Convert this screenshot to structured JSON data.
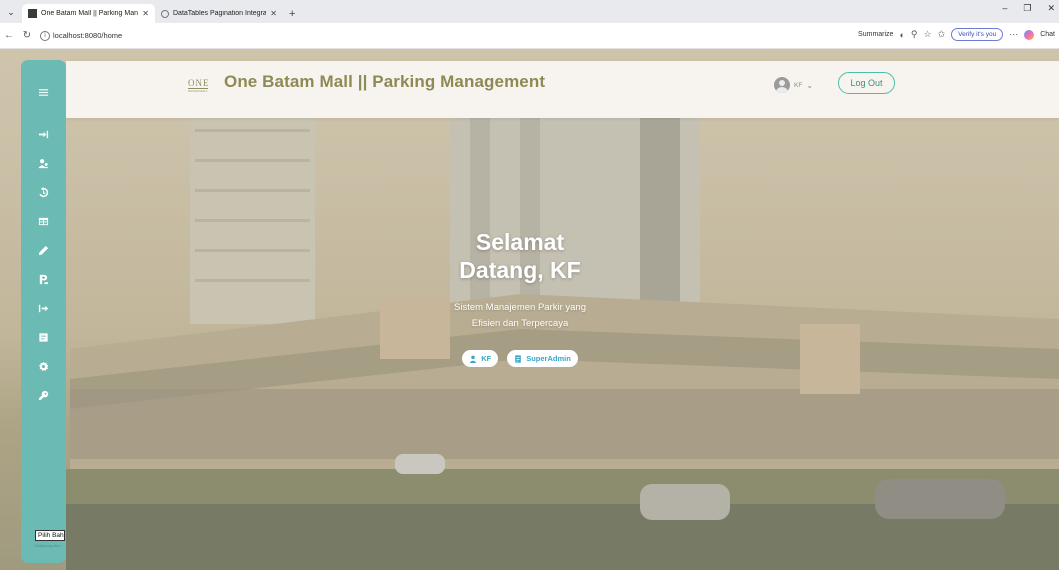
{
  "browser": {
    "tabs": [
      {
        "title": "One Batam Mall || Parking Manage",
        "active": true
      },
      {
        "title": "DataTables Pagination Integration",
        "active": false
      }
    ],
    "url": "localhost:8080/home",
    "summarize_label": "Summarize",
    "verify_label": "Verify it's you",
    "chat_label": "Chat"
  },
  "header": {
    "logo_text": "ONE",
    "logo_sub": "BATAM MALL",
    "title": "One Batam Mall || Parking Management",
    "user_name": "KF",
    "logout_label": "Log Out"
  },
  "sidebar": {
    "icons": [
      "menu-icon",
      "sign-in-icon",
      "users-icon",
      "history-icon",
      "table-icon",
      "pen-icon",
      "parking-icon",
      "sign-out-icon",
      "report-icon",
      "settings-icon",
      "key-icon"
    ],
    "language_select": "Pilih Bahasa",
    "language_sub": "Didukung oleh"
  },
  "hero": {
    "title_line1": "Selamat",
    "title_line2": "Datang, KF",
    "subtitle_line1": "Sistem Manajemen Parkir yang",
    "subtitle_line2": "Efisien dan Terpercaya",
    "badge_user": "KF",
    "badge_role": "SuperAdmin"
  },
  "colors": {
    "sidebar": "#6bbab3",
    "title": "#8e8a55",
    "accent": "#4bbfa9",
    "badge_text": "#3aa6c9"
  }
}
